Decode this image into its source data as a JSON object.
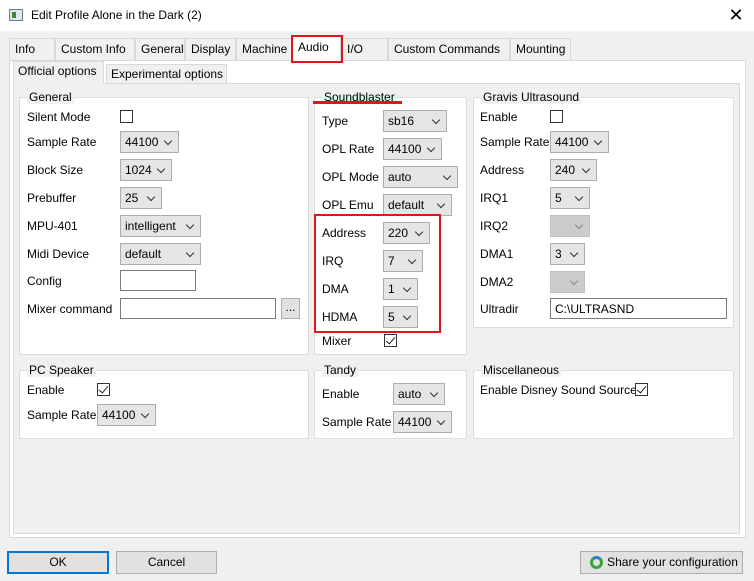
{
  "window": {
    "title": "Edit Profile Alone in the Dark (2)",
    "close_glyph": "✕"
  },
  "tabs": [
    "Info",
    "Custom Info",
    "General",
    "Display",
    "Machine",
    "Audio",
    "I/O",
    "Custom Commands",
    "Mounting"
  ],
  "subtabs": [
    "Official options",
    "Experimental options"
  ],
  "general": {
    "title": "General",
    "silent_mode": {
      "label": "Silent Mode",
      "checked": false
    },
    "sample_rate": {
      "label": "Sample Rate",
      "value": "44100"
    },
    "block_size": {
      "label": "Block Size",
      "value": "1024"
    },
    "prebuffer": {
      "label": "Prebuffer",
      "value": "25"
    },
    "mpu401": {
      "label": "MPU-401",
      "value": "intelligent"
    },
    "midi_device": {
      "label": "Midi Device",
      "value": "default"
    },
    "config": {
      "label": "Config",
      "value": ""
    },
    "mixer_command": {
      "label": "Mixer command",
      "value": "",
      "browse": "..."
    }
  },
  "soundblaster": {
    "title": "Soundblaster",
    "type": {
      "label": "Type",
      "value": "sb16"
    },
    "opl_rate": {
      "label": "OPL Rate",
      "value": "44100"
    },
    "opl_mode": {
      "label": "OPL Mode",
      "value": "auto"
    },
    "opl_emu": {
      "label": "OPL Emu",
      "value": "default"
    },
    "address": {
      "label": "Address",
      "value": "220"
    },
    "irq": {
      "label": "IRQ",
      "value": "7"
    },
    "dma": {
      "label": "DMA",
      "value": "1"
    },
    "hdma": {
      "label": "HDMA",
      "value": "5"
    },
    "mixer": {
      "label": "Mixer",
      "checked": true
    }
  },
  "gus": {
    "title": "Gravis Ultrasound",
    "enable": {
      "label": "Enable",
      "checked": false
    },
    "sample_rate": {
      "label": "Sample Rate",
      "value": "44100"
    },
    "address": {
      "label": "Address",
      "value": "240"
    },
    "irq1": {
      "label": "IRQ1",
      "value": "5"
    },
    "irq2": {
      "label": "IRQ2",
      "value": ""
    },
    "dma1": {
      "label": "DMA1",
      "value": "3"
    },
    "dma2": {
      "label": "DMA2",
      "value": ""
    },
    "ultradir": {
      "label": "Ultradir",
      "value": "C:\\ULTRASND"
    }
  },
  "pc_speaker": {
    "title": "PC Speaker",
    "enable": {
      "label": "Enable",
      "checked": true
    },
    "sample_rate": {
      "label": "Sample Rate",
      "value": "44100"
    }
  },
  "tandy": {
    "title": "Tandy",
    "enable": {
      "label": "Enable",
      "value": "auto"
    },
    "sample_rate": {
      "label": "Sample Rate",
      "value": "44100"
    }
  },
  "misc": {
    "title": "Miscellaneous",
    "disney": {
      "label": "Enable Disney Sound Source",
      "checked": true
    }
  },
  "buttons": {
    "ok": "OK",
    "cancel": "Cancel",
    "share": "Share your configuration"
  },
  "colors": {
    "highlight": "#e0141c",
    "focus": "#0078d7"
  },
  "icons": {
    "share": "share-icon",
    "app": "app-icon",
    "close": "close-icon"
  }
}
